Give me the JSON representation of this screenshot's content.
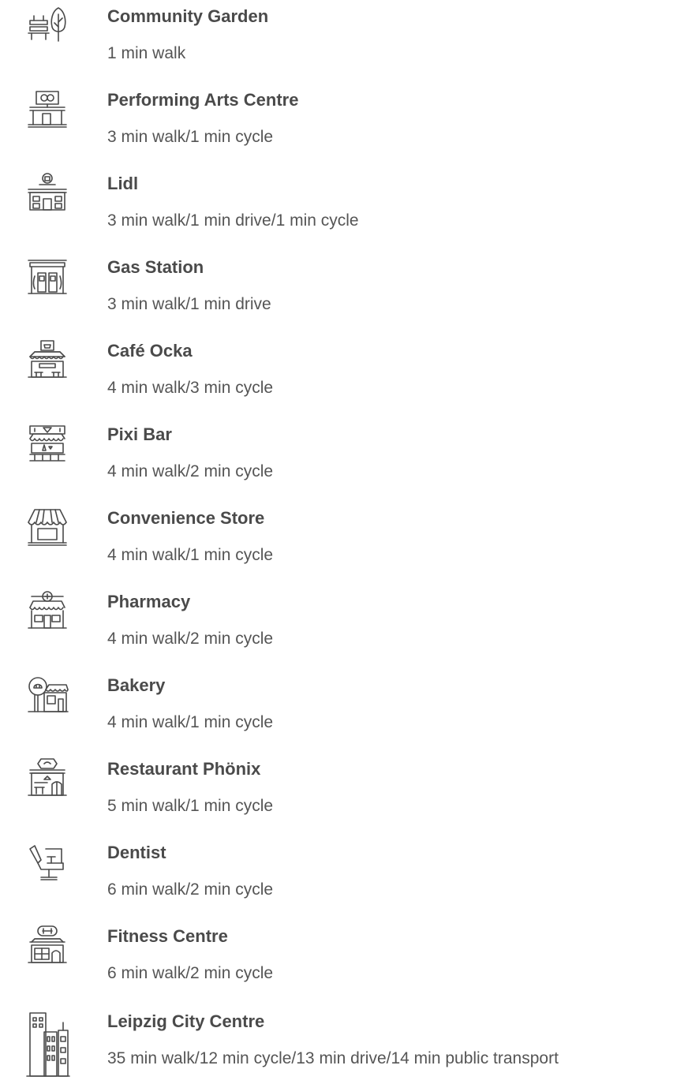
{
  "points_of_interest": [
    {
      "name": "Community Garden",
      "travel": "1 min walk",
      "icon": "park-bench-tree-icon"
    },
    {
      "name": "Performing Arts Centre",
      "travel": "3 min walk/1 min cycle",
      "icon": "theatre-masks-building-icon"
    },
    {
      "name": "Lidl",
      "travel": "3 min walk/1 min drive/1 min cycle",
      "icon": "shopping-bag-building-icon"
    },
    {
      "name": "Gas Station",
      "travel": "3 min walk/1 min drive",
      "icon": "gas-station-icon"
    },
    {
      "name": "Café Ocka",
      "travel": "4 min walk/3 min cycle",
      "icon": "cafe-storefront-icon"
    },
    {
      "name": "Pixi Bar",
      "travel": "4 min walk/2 min cycle",
      "icon": "bar-storefront-icon"
    },
    {
      "name": "Convenience Store",
      "travel": "4 min walk/1 min cycle",
      "icon": "convenience-store-icon"
    },
    {
      "name": "Pharmacy",
      "travel": "4 min walk/2 min cycle",
      "icon": "pharmacy-storefront-icon"
    },
    {
      "name": "Bakery",
      "travel": "4 min walk/1 min cycle",
      "icon": "bakery-storefront-icon"
    },
    {
      "name": "Restaurant Phönix",
      "travel": "5 min walk/1 min cycle",
      "icon": "restaurant-storefront-icon"
    },
    {
      "name": "Dentist",
      "travel": "6 min walk/2 min cycle",
      "icon": "dentist-chair-icon"
    },
    {
      "name": "Fitness Centre",
      "travel": "6 min walk/2 min cycle",
      "icon": "fitness-centre-dumbbell-icon"
    },
    {
      "name": "Leipzig City Centre",
      "travel": "35 min walk/12 min cycle/13 min drive/14 min public transport",
      "icon": "city-skyline-icon"
    }
  ],
  "colors": {
    "text_primary": "#4a4a4a",
    "text_secondary": "#555555",
    "icon_stroke": "#4a4a4a",
    "background": "#ffffff"
  }
}
